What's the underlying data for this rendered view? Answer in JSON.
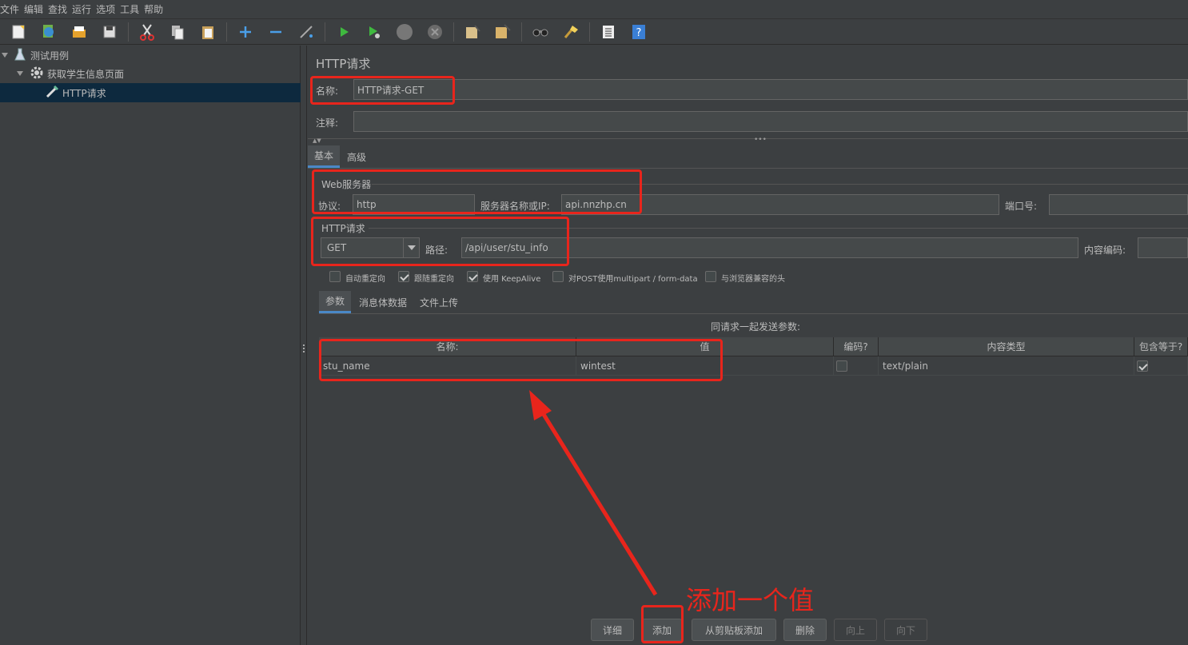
{
  "menu": [
    "文件",
    "编辑",
    "查找",
    "运行",
    "选项",
    "工具",
    "帮助"
  ],
  "toolbar_icons": [
    "new-icon",
    "templates-icon",
    "open-icon",
    "save-icon",
    "cut-icon",
    "copy-icon",
    "paste-icon",
    "expand-icon",
    "collapse-icon",
    "toggle-icon",
    "start-icon",
    "start-no-pause-icon",
    "stop-icon",
    "shutdown-icon",
    "clear-icon",
    "clear-all-icon",
    "search-icon",
    "reset-search-icon",
    "function-helper-icon",
    "help-icon"
  ],
  "tree": {
    "items": [
      {
        "label": "测试用例",
        "icon": "flask-icon"
      },
      {
        "label": "获取学生信息页面",
        "icon": "gear-icon"
      },
      {
        "label": "HTTP请求",
        "icon": "pipette-icon"
      }
    ]
  },
  "panel": {
    "title": "HTTP请求",
    "name_label": "名称:",
    "name_value": "HTTP请求-GET",
    "comment_label": "注释:",
    "comment_value": "",
    "tabs": [
      "基本",
      "高级"
    ],
    "web_server": {
      "group_title": "Web服务器",
      "protocol_label": "协议:",
      "protocol_value": "http",
      "server_label": "服务器名称或IP:",
      "server_value": "api.nnzhp.cn",
      "port_label": "端口号:",
      "port_value": ""
    },
    "http_request": {
      "group_title": "HTTP请求",
      "method": "GET",
      "path_label": "路径:",
      "path_value": "/api/user/stu_info",
      "encoding_label": "内容编码:",
      "encoding_value": ""
    },
    "checkboxes": [
      {
        "label": "自动重定向",
        "checked": false
      },
      {
        "label": "跟随重定向",
        "checked": true
      },
      {
        "label": "使用 KeepAlive",
        "checked": true
      },
      {
        "label": "对POST使用multipart / form-data",
        "checked": false
      },
      {
        "label": "与浏览器兼容的头",
        "checked": false
      }
    ],
    "sub_tabs": [
      "参数",
      "消息体数据",
      "文件上传"
    ],
    "params_caption": "同请求一起发送参数:",
    "table": {
      "headers": [
        "名称:",
        "值",
        "编码?",
        "内容类型",
        "包含等于?"
      ],
      "rows": [
        {
          "name": "stu_name",
          "value": "wintest",
          "encode": false,
          "content_type": "text/plain",
          "include_equals": true
        }
      ]
    },
    "buttons": {
      "detail": "详细",
      "add": "添加",
      "add_clipboard": "从剪贴板添加",
      "delete": "删除",
      "up": "向上",
      "down": "向下"
    }
  },
  "annotation": {
    "text": "添加一个值",
    "color": "#e8251c"
  }
}
